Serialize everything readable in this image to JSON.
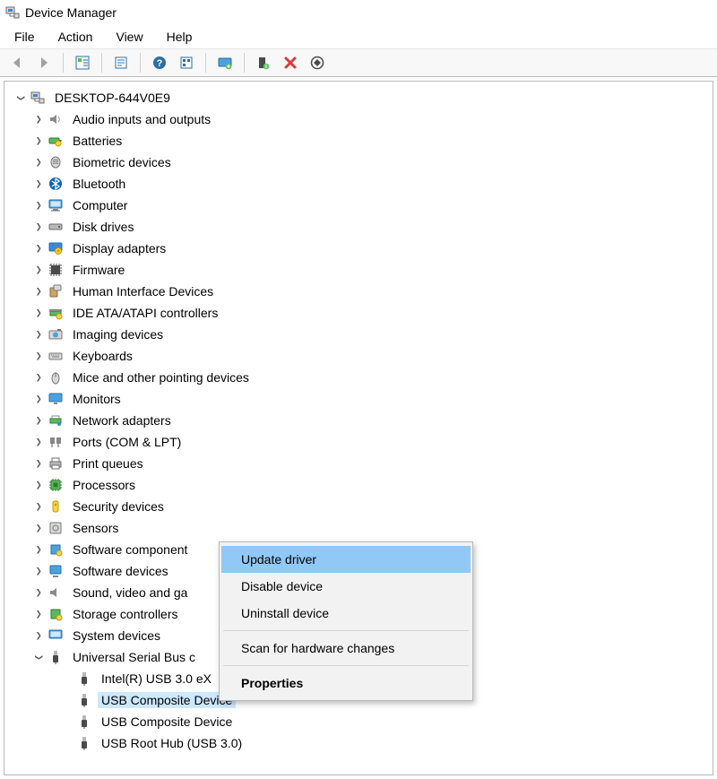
{
  "window": {
    "title": "Device Manager"
  },
  "menu": {
    "file": "File",
    "action": "Action",
    "view": "View",
    "help": "Help"
  },
  "tree": {
    "root": {
      "label": "DESKTOP-644V0E9"
    },
    "categories": [
      {
        "label": "Audio inputs and outputs",
        "icon": "speaker"
      },
      {
        "label": "Batteries",
        "icon": "battery"
      },
      {
        "label": "Biometric devices",
        "icon": "biometric"
      },
      {
        "label": "Bluetooth",
        "icon": "bluetooth"
      },
      {
        "label": "Computer",
        "icon": "computer"
      },
      {
        "label": "Disk drives",
        "icon": "disk"
      },
      {
        "label": "Display adapters",
        "icon": "display"
      },
      {
        "label": "Firmware",
        "icon": "firmware"
      },
      {
        "label": "Human Interface Devices",
        "icon": "hid"
      },
      {
        "label": "IDE ATA/ATAPI controllers",
        "icon": "ide"
      },
      {
        "label": "Imaging devices",
        "icon": "imaging"
      },
      {
        "label": "Keyboards",
        "icon": "keyboard"
      },
      {
        "label": "Mice and other pointing devices",
        "icon": "mouse"
      },
      {
        "label": "Monitors",
        "icon": "monitor"
      },
      {
        "label": "Network adapters",
        "icon": "network"
      },
      {
        "label": "Ports (COM & LPT)",
        "icon": "ports"
      },
      {
        "label": "Print queues",
        "icon": "printer"
      },
      {
        "label": "Processors",
        "icon": "processor"
      },
      {
        "label": "Security devices",
        "icon": "security"
      },
      {
        "label": "Sensors",
        "icon": "sensor"
      },
      {
        "label": "Software component",
        "icon": "softcomp"
      },
      {
        "label": "Software devices",
        "icon": "softdev"
      },
      {
        "label": "Sound, video and ga",
        "icon": "sound"
      },
      {
        "label": "Storage controllers",
        "icon": "storage"
      },
      {
        "label": "System devices",
        "icon": "system"
      }
    ],
    "usb_category": {
      "label": "Universal Serial Bus c"
    },
    "usb_children": [
      {
        "label": "Intel(R) USB 3.0 eX",
        "selected": false
      },
      {
        "label": "USB Composite Device",
        "selected": true
      },
      {
        "label": "USB Composite Device",
        "selected": false
      },
      {
        "label": "USB Root Hub (USB 3.0)",
        "selected": false
      }
    ]
  },
  "context_menu": {
    "update": "Update driver",
    "disable": "Disable device",
    "uninstall": "Uninstall device",
    "scan": "Scan for hardware changes",
    "properties": "Properties"
  }
}
